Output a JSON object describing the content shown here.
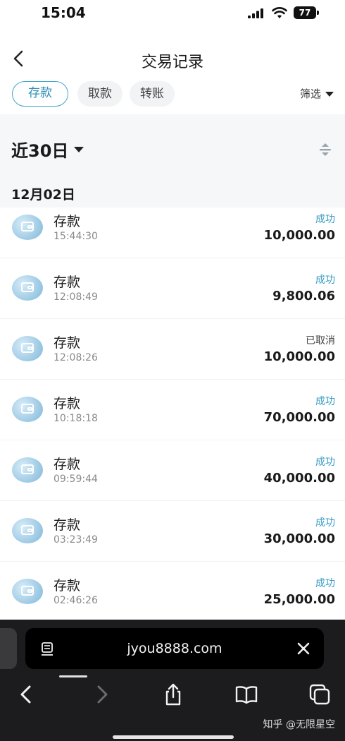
{
  "status_bar": {
    "time": "15:04",
    "battery": "77"
  },
  "header": {
    "title": "交易记录"
  },
  "tabs": [
    {
      "label": "存款",
      "active": true
    },
    {
      "label": "取款",
      "active": false
    },
    {
      "label": "转账",
      "active": false
    }
  ],
  "filter": {
    "label": "筛选"
  },
  "range": {
    "label": "近30日"
  },
  "group": {
    "date": "12月02日"
  },
  "transactions": [
    {
      "type": "存款",
      "time": "15:44:30",
      "status": "成功",
      "amount": "10,000.00"
    },
    {
      "type": "存款",
      "time": "12:08:49",
      "status": "成功",
      "amount": "9,800.06"
    },
    {
      "type": "存款",
      "time": "12:08:26",
      "status": "已取消",
      "amount": "10,000.00"
    },
    {
      "type": "存款",
      "time": "10:18:18",
      "status": "成功",
      "amount": "70,000.00"
    },
    {
      "type": "存款",
      "time": "09:59:44",
      "status": "成功",
      "amount": "40,000.00"
    },
    {
      "type": "存款",
      "time": "03:23:49",
      "status": "成功",
      "amount": "30,000.00"
    },
    {
      "type": "存款",
      "time": "02:46:26",
      "status": "成功",
      "amount": "25,000.00"
    }
  ],
  "browser": {
    "url": "jyou8888.com"
  },
  "watermark": "知乎 @无限星空",
  "colors": {
    "accent": "#2f8fb3",
    "success": "#3a9cc4",
    "cancelled": "#444444",
    "chrome": "#1c1c1e"
  }
}
